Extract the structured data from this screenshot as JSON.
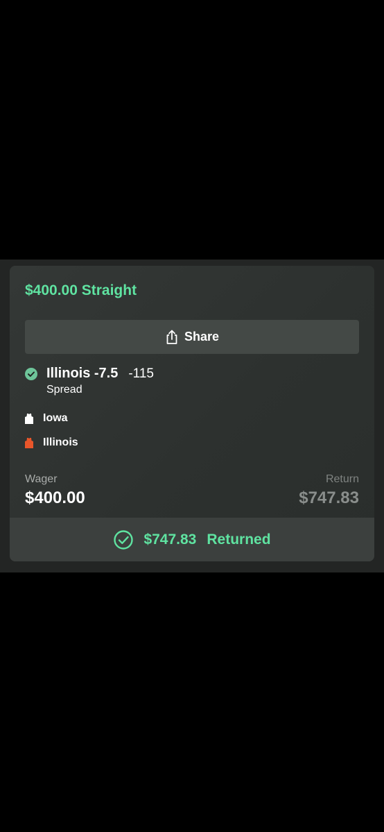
{
  "bet": {
    "title": "$400.00 Straight",
    "share_label": "Share",
    "pick": {
      "name": "Illinois -7.5",
      "odds": "-115",
      "type": "Spread"
    },
    "teams": [
      {
        "name": "Iowa",
        "jersey_color": "#ffffff"
      },
      {
        "name": "Illinois",
        "jersey_color": "#e8562a"
      }
    ],
    "wager_label": "Wager",
    "wager_value": "$400.00",
    "return_label": "Return",
    "return_value": "$747.83",
    "status": {
      "amount": "$747.83",
      "text": "Returned",
      "icon": "check-circle-icon"
    }
  },
  "colors": {
    "accent": "#5fe3a1",
    "card": "#313533",
    "status_bar": "#3c403e"
  }
}
